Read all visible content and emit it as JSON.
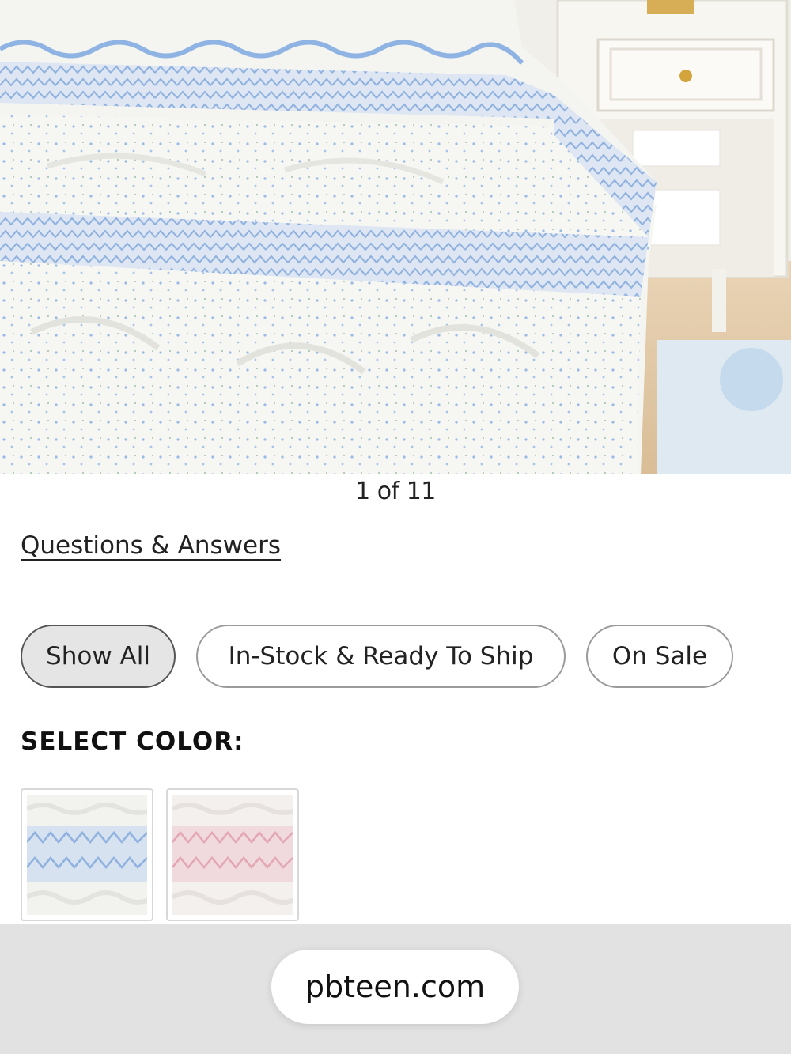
{
  "gallery": {
    "image_description_icon": "product-image-bedding",
    "counter": "1 of 11"
  },
  "questions_link": "Questions & Answers",
  "filters": [
    {
      "label": "Show All",
      "selected": true
    },
    {
      "label": "In-Stock & Ready To Ship",
      "selected": false
    },
    {
      "label": "On Sale",
      "selected": false
    }
  ],
  "select_color_label": "SELECT COLOR:",
  "swatches": [
    {
      "color": "#a9c3e6",
      "icon": "blue-smocked-swatch"
    },
    {
      "color": "#e8b7c0",
      "icon": "pink-smocked-swatch"
    }
  ],
  "browser": {
    "url": "pbteen.com"
  }
}
